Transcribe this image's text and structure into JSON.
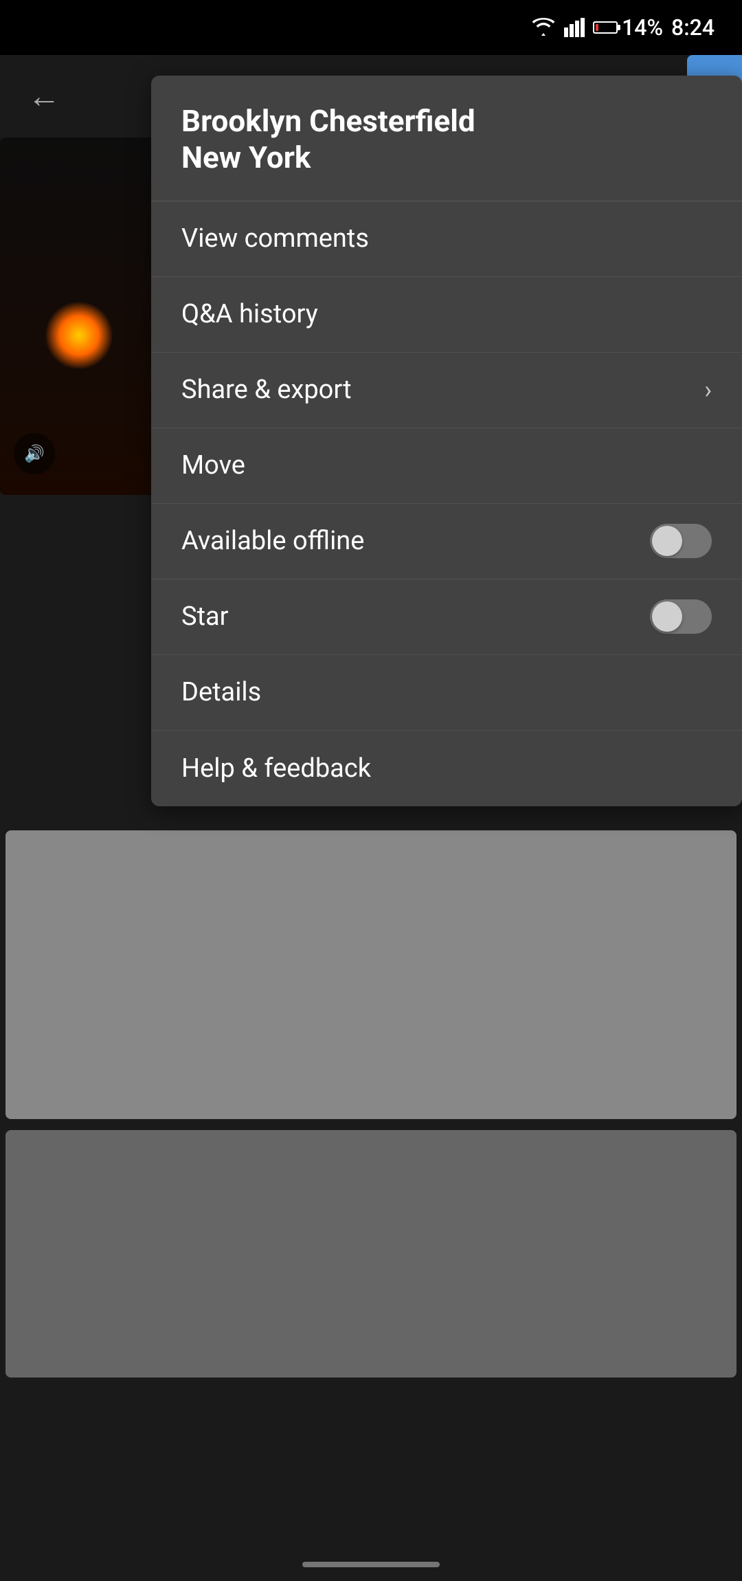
{
  "statusBar": {
    "battery": "14%",
    "time": "8:24"
  },
  "topBar": {
    "backLabel": "←"
  },
  "menu": {
    "title": "Brooklyn Chesterfield\nNew York",
    "items": [
      {
        "id": "view-comments",
        "label": "View comments",
        "type": "action",
        "hasChevron": false
      },
      {
        "id": "qa-history",
        "label": "Q&A history",
        "type": "action",
        "hasChevron": false
      },
      {
        "id": "share-export",
        "label": "Share & export",
        "type": "action",
        "hasChevron": true
      },
      {
        "id": "move",
        "label": "Move",
        "type": "action",
        "hasChevron": false
      },
      {
        "id": "available-offline",
        "label": "Available offline",
        "type": "toggle",
        "toggled": false
      },
      {
        "id": "star",
        "label": "Star",
        "type": "toggle",
        "toggled": false
      },
      {
        "id": "details",
        "label": "Details",
        "type": "action",
        "hasChevron": false
      },
      {
        "id": "help-feedback",
        "label": "Help & feedback",
        "type": "action",
        "hasChevron": false
      }
    ]
  },
  "icons": {
    "back": "←",
    "chevron": "›",
    "wifi": "▲",
    "speaker": "🔊"
  }
}
